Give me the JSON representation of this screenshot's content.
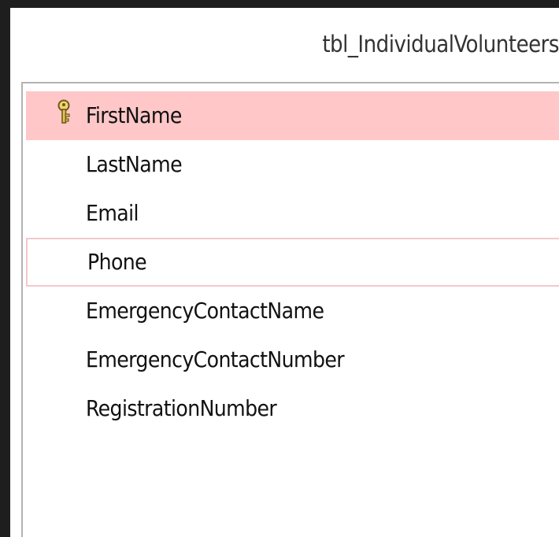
{
  "table": {
    "title": "tbl_IndividualVolunteers",
    "fields": [
      {
        "name": "FirstName",
        "primary_key": true,
        "selected": true
      },
      {
        "name": "LastName"
      },
      {
        "name": "Email"
      },
      {
        "name": "Phone",
        "focused": true
      },
      {
        "name": "EmergencyContactName"
      },
      {
        "name": "EmergencyContactNumber"
      },
      {
        "name": "RegistrationNumber"
      }
    ]
  },
  "icons": {
    "primary_key": "key-icon"
  },
  "colors": {
    "selected_row": "#ffc7c8",
    "focus_border": "#f3c9cc",
    "key_gold": "#e8c24a"
  }
}
